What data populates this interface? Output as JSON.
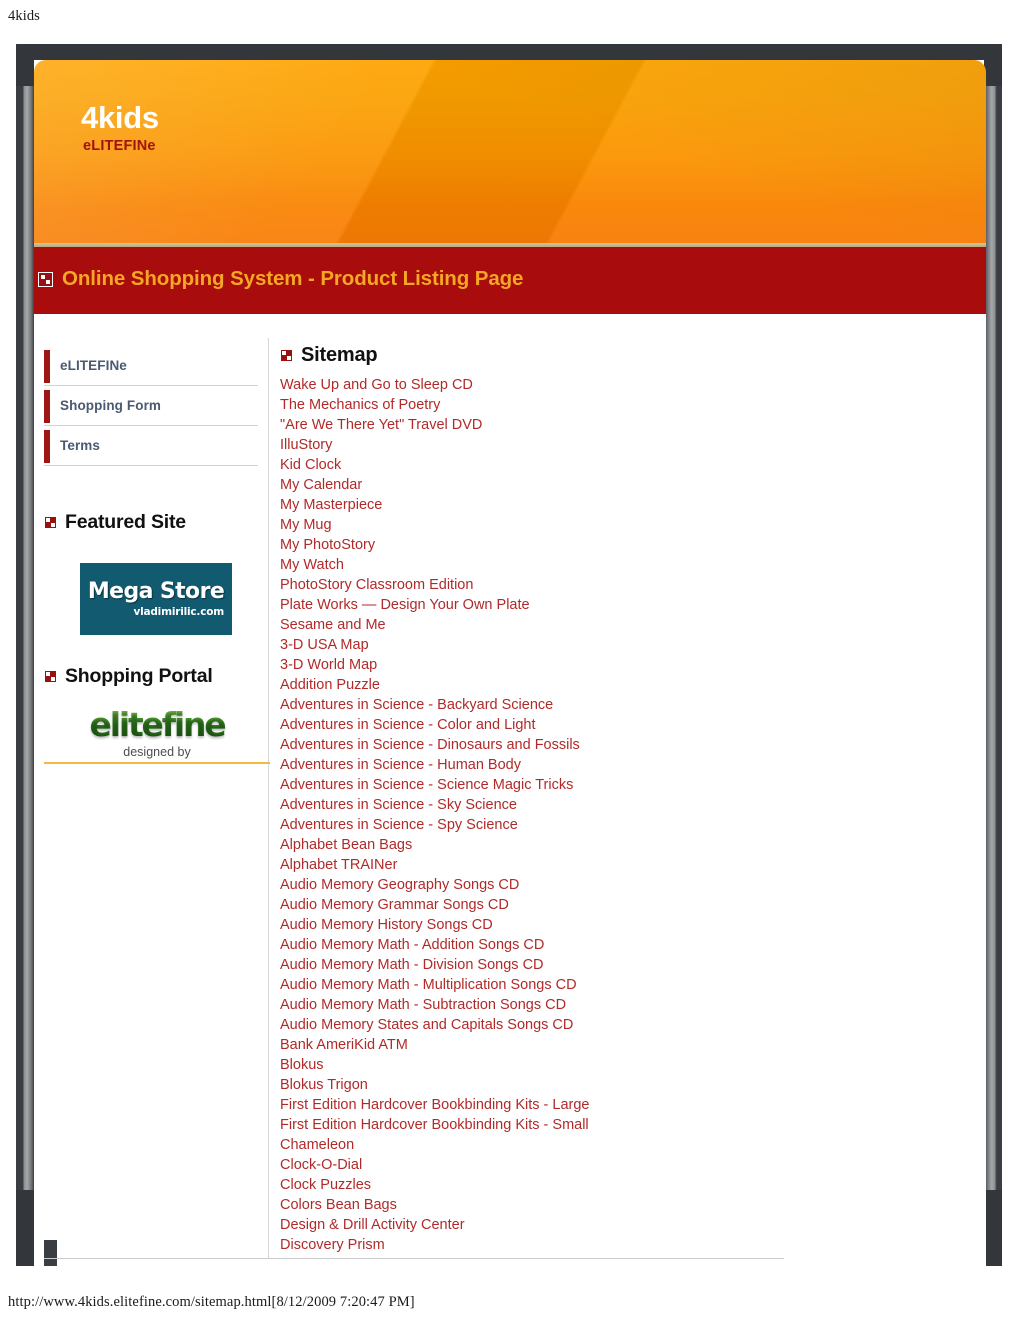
{
  "browser": {
    "print_title": "4kids",
    "print_footer": "http://www.4kids.elitefine.com/sitemap.html[8/12/2009 7:20:47 PM]"
  },
  "colors": {
    "banner_orange": "#fb9400",
    "title_bar_red": "#a80c0c",
    "title_text_orange": "#f5a623",
    "link_red": "#b12a2a",
    "nav_bar_red": "#a01616",
    "nav_label_slate": "#4a5a72",
    "megastore_teal": "#115a70",
    "elitefine_green": "#2f7d1f",
    "frame_dark": "#33363a"
  },
  "hero": {
    "title": "4kids",
    "subtitle": "eLITEFINe"
  },
  "titlebar": {
    "icon": "bullet-square-icon",
    "text": "Online Shopping System - Product Listing Page"
  },
  "sidebar": {
    "nav": [
      {
        "label": "eLITEFINe"
      },
      {
        "label": "Shopping Form"
      },
      {
        "label": "Terms"
      }
    ],
    "featured_site": {
      "icon": "bullet-square-icon",
      "heading": "Featured Site",
      "logo_title": "Mega Store",
      "logo_subtitle": "vladimirilic.com"
    },
    "shopping_portal": {
      "icon": "bullet-square-icon",
      "heading": "Shopping Portal",
      "logo_text": "elitefine",
      "designed_by": "designed by"
    }
  },
  "main": {
    "icon": "bullet-square-icon",
    "heading": "Sitemap",
    "links": [
      "Wake Up and Go to Sleep CD",
      "The Mechanics of Poetry",
      "\"Are We There Yet\" Travel DVD",
      "IlluStory",
      "Kid Clock",
      "My Calendar",
      "My Masterpiece",
      "My Mug",
      "My PhotoStory",
      "My Watch",
      "PhotoStory Classroom Edition",
      "Plate Works — Design Your Own Plate",
      "Sesame and Me",
      "3-D USA Map",
      "3-D World Map",
      "Addition Puzzle",
      "Adventures in Science - Backyard Science",
      "Adventures in Science - Color and Light",
      "Adventures in Science - Dinosaurs and Fossils",
      "Adventures in Science - Human Body",
      "Adventures in Science - Science Magic Tricks",
      "Adventures in Science - Sky Science",
      "Adventures in Science - Spy Science",
      "Alphabet Bean Bags",
      "Alphabet TRAINer",
      "Audio Memory Geography Songs CD",
      "Audio Memory Grammar Songs CD",
      "Audio Memory History Songs CD",
      "Audio Memory Math - Addition Songs CD",
      "Audio Memory Math - Division Songs CD",
      "Audio Memory Math - Multiplication Songs CD",
      "Audio Memory Math - Subtraction Songs CD",
      "Audio Memory States and Capitals Songs CD",
      "Bank AmeriKid ATM",
      "Blokus",
      "Blokus Trigon",
      "First Edition Hardcover Bookbinding Kits - Large",
      "First Edition Hardcover Bookbinding Kits - Small",
      "Chameleon",
      "Clock-O-Dial",
      "Clock Puzzles",
      "Colors Bean Bags",
      "Design & Drill Activity Center",
      "Discovery Prism"
    ]
  }
}
